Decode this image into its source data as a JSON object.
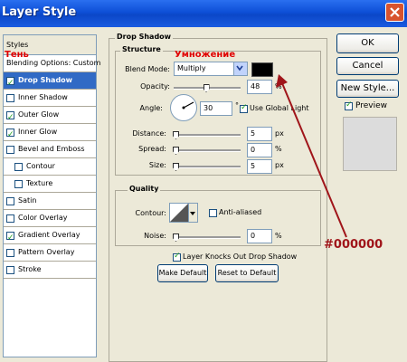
{
  "window": {
    "title": "Layer Style"
  },
  "styles_panel": {
    "header": "Styles",
    "items": [
      {
        "label": "Blending Options: Custom",
        "has_checkbox": false,
        "checked": false,
        "selected": false,
        "indent": false
      },
      {
        "label": "Drop Shadow",
        "has_checkbox": true,
        "checked": true,
        "selected": true,
        "indent": false
      },
      {
        "label": "Inner Shadow",
        "has_checkbox": true,
        "checked": false,
        "selected": false,
        "indent": false
      },
      {
        "label": "Outer Glow",
        "has_checkbox": true,
        "checked": true,
        "selected": false,
        "indent": false
      },
      {
        "label": "Inner Glow",
        "has_checkbox": true,
        "checked": true,
        "selected": false,
        "indent": false
      },
      {
        "label": "Bevel and Emboss",
        "has_checkbox": true,
        "checked": false,
        "selected": false,
        "indent": false
      },
      {
        "label": "Contour",
        "has_checkbox": true,
        "checked": false,
        "selected": false,
        "indent": true
      },
      {
        "label": "Texture",
        "has_checkbox": true,
        "checked": false,
        "selected": false,
        "indent": true
      },
      {
        "label": "Satin",
        "has_checkbox": true,
        "checked": false,
        "selected": false,
        "indent": false
      },
      {
        "label": "Color Overlay",
        "has_checkbox": true,
        "checked": false,
        "selected": false,
        "indent": false
      },
      {
        "label": "Gradient Overlay",
        "has_checkbox": true,
        "checked": true,
        "selected": false,
        "indent": false
      },
      {
        "label": "Pattern Overlay",
        "has_checkbox": true,
        "checked": false,
        "selected": false,
        "indent": false
      },
      {
        "label": "Stroke",
        "has_checkbox": true,
        "checked": false,
        "selected": false,
        "indent": false
      }
    ]
  },
  "drop_shadow": {
    "title": "Drop Shadow",
    "structure_title": "Structure",
    "blend_mode": {
      "label": "Blend Mode:",
      "value": "Multiply",
      "color": "#000000"
    },
    "opacity": {
      "label": "Opacity:",
      "value": "48",
      "unit": "%",
      "level": 0.48
    },
    "angle": {
      "label": "Angle:",
      "value": "30",
      "unit": "°",
      "use_global_light_label": "Use Global Light",
      "use_global_light": true
    },
    "distance": {
      "label": "Distance:",
      "value": "5",
      "unit": "px"
    },
    "spread": {
      "label": "Spread:",
      "value": "0",
      "unit": "%"
    },
    "size": {
      "label": "Size:",
      "value": "5",
      "unit": "px"
    },
    "quality_title": "Quality",
    "contour": {
      "label": "Contour:",
      "anti_aliased_label": "Anti-aliased",
      "anti_aliased": false
    },
    "noise": {
      "label": "Noise:",
      "value": "0",
      "unit": "%"
    },
    "knockout_label": "Layer Knocks Out Drop Shadow",
    "knockout": true,
    "make_default": "Make Default",
    "reset_default": "Reset to Default"
  },
  "side_buttons": {
    "ok": "OK",
    "cancel": "Cancel",
    "new_style": "New Style...",
    "preview_label": "Preview",
    "preview": true
  },
  "annotations": {
    "ten": "Тень",
    "umnozhenie": "Умножение",
    "hex": "#000000",
    "color": "#e00000"
  }
}
